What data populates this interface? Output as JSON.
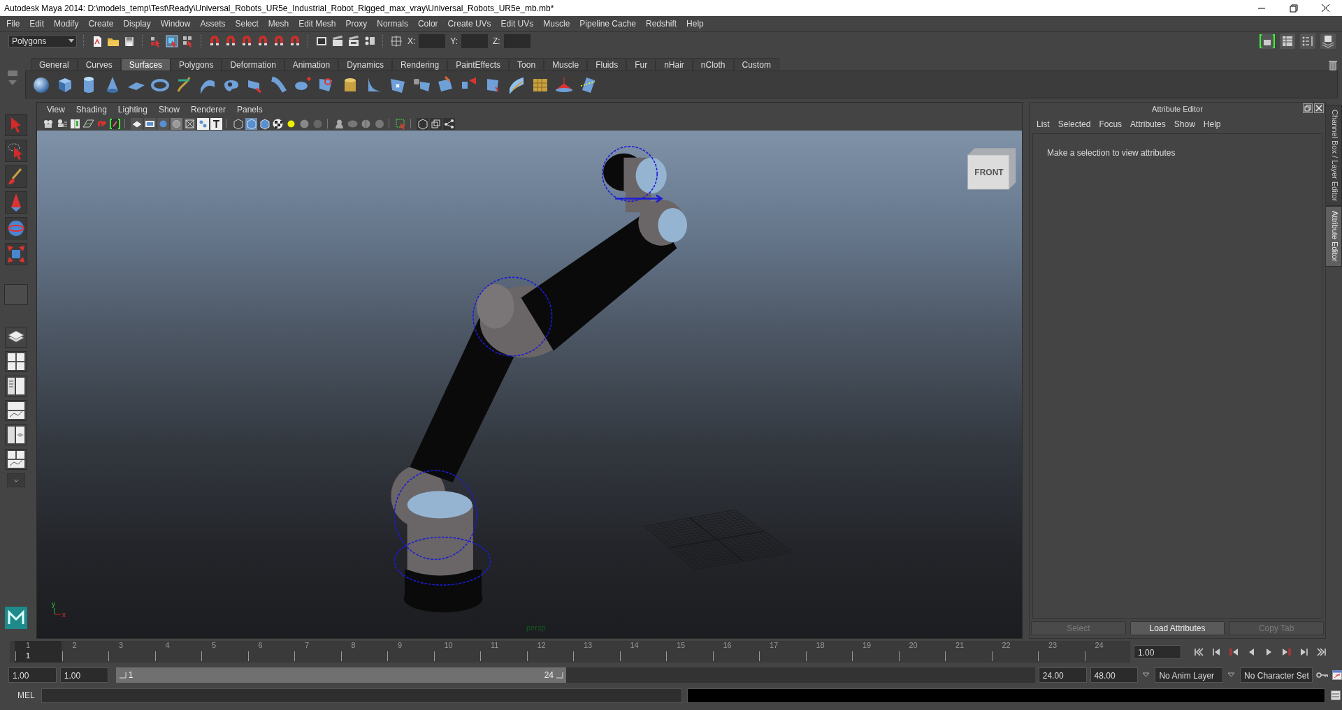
{
  "window": {
    "title": "Autodesk Maya 2014: D:\\models_temp\\Test\\Ready\\Universal_Robots_UR5e_Industrial_Robot_Rigged_max_vray\\Universal_Robots_UR5e_mb.mb*"
  },
  "menu_bar": [
    "File",
    "Edit",
    "Modify",
    "Create",
    "Display",
    "Window",
    "Assets",
    "Select",
    "Mesh",
    "Edit Mesh",
    "Proxy",
    "Normals",
    "Color",
    "Create UVs",
    "Edit UVs",
    "Muscle",
    "Pipeline Cache",
    "Redshift",
    "Help"
  ],
  "status_line": {
    "mode_dropdown": "Polygons",
    "coordinate_labels": [
      "X:",
      "Y:",
      "Z:"
    ]
  },
  "shelf": {
    "tabs": [
      {
        "label": "General",
        "selected": false
      },
      {
        "label": "Curves",
        "selected": false
      },
      {
        "label": "Surfaces",
        "selected": true
      },
      {
        "label": "Polygons",
        "selected": false
      },
      {
        "label": "Deformation",
        "selected": false
      },
      {
        "label": "Animation",
        "selected": false
      },
      {
        "label": "Dynamics",
        "selected": false
      },
      {
        "label": "Rendering",
        "selected": false
      },
      {
        "label": "PaintEffects",
        "selected": false
      },
      {
        "label": "Toon",
        "selected": false
      },
      {
        "label": "Muscle",
        "selected": false
      },
      {
        "label": "Fluids",
        "selected": false
      },
      {
        "label": "Fur",
        "selected": false
      },
      {
        "label": "nHair",
        "selected": false
      },
      {
        "label": "nCloth",
        "selected": false
      },
      {
        "label": "Custom",
        "selected": false
      }
    ]
  },
  "viewport": {
    "menus": [
      "View",
      "Shading",
      "Lighting",
      "Show",
      "Renderer",
      "Panels"
    ],
    "view_cube_label": "FRONT",
    "axis_labels": [
      "y",
      "x"
    ],
    "camera_label": "persp"
  },
  "attribute_editor": {
    "title": "Attribute Editor",
    "menus": [
      "List",
      "Selected",
      "Focus",
      "Attributes",
      "Show",
      "Help"
    ],
    "message": "Make a selection to view attributes",
    "buttons": [
      {
        "label": "Select",
        "disabled": true
      },
      {
        "label": "Load Attributes",
        "disabled": false
      },
      {
        "label": "Copy Tab",
        "disabled": true
      }
    ]
  },
  "side_tabs": [
    {
      "label": "Channel Box / Layer Editor",
      "selected": false
    },
    {
      "label": "Attribute Editor",
      "selected": true
    }
  ],
  "time_slider": {
    "ticks": [
      {
        "label": "1",
        "selected": true
      },
      {
        "label": "2",
        "selected": false
      },
      {
        "label": "3",
        "selected": false
      },
      {
        "label": "4",
        "selected": false
      },
      {
        "label": "5",
        "selected": false
      },
      {
        "label": "6",
        "selected": false
      },
      {
        "label": "7",
        "selected": false
      },
      {
        "label": "8",
        "selected": false
      },
      {
        "label": "9",
        "selected": false
      },
      {
        "label": "10",
        "selected": false
      },
      {
        "label": "11",
        "selected": false
      },
      {
        "label": "12",
        "selected": false
      },
      {
        "label": "13",
        "selected": false
      },
      {
        "label": "14",
        "selected": false
      },
      {
        "label": "15",
        "selected": false
      },
      {
        "label": "16",
        "selected": false
      },
      {
        "label": "17",
        "selected": false
      },
      {
        "label": "18",
        "selected": false
      },
      {
        "label": "19",
        "selected": false
      },
      {
        "label": "20",
        "selected": false
      },
      {
        "label": "21",
        "selected": false
      },
      {
        "label": "22",
        "selected": false
      },
      {
        "label": "23",
        "selected": false
      },
      {
        "label": "24",
        "selected": false
      }
    ],
    "current_frame": "1",
    "current_time": "1.00"
  },
  "range_slider": {
    "start_time": "1.00",
    "playback_start": "1.00",
    "range_start": "1",
    "range_end": "24",
    "playback_end": "24.00",
    "end_time": "48.00",
    "anim_layer": "No Anim Layer",
    "character_set": "No Character Set"
  },
  "command_line": {
    "label": "MEL"
  }
}
